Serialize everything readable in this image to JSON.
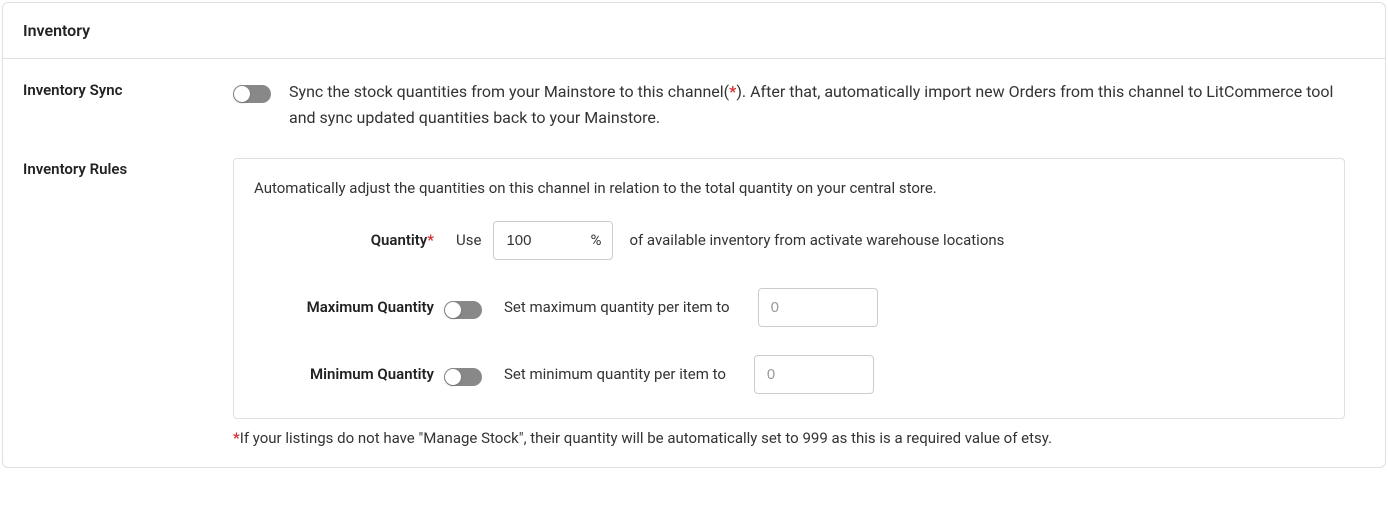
{
  "header": {
    "title": "Inventory"
  },
  "sync": {
    "label": "Inventory Sync",
    "text_before": "Sync the stock quantities from your Mainstore to this channel(",
    "asterisk": "*",
    "text_after": "). After that, automatically import new Orders from this channel to LitCommerce tool and sync updated quantities back to your Mainstore."
  },
  "rules": {
    "label": "Inventory Rules",
    "intro": "Automatically adjust the quantities on this channel in relation to the total quantity on your central store.",
    "quantity": {
      "label": "Quantity",
      "required": "*",
      "use": "Use",
      "value": "100",
      "unit": "%",
      "suffix": "of available inventory from activate warehouse locations"
    },
    "max": {
      "label": "Maximum Quantity",
      "text": "Set maximum quantity per item to",
      "placeholder": "0"
    },
    "min": {
      "label": "Minimum Quantity",
      "text": "Set minimum quantity per item to",
      "placeholder": "0"
    },
    "footnote": {
      "asterisk": "*",
      "text": "If your listings do not have \"Manage Stock\", their quantity will be automatically set to 999 as this is a required value of etsy."
    }
  }
}
